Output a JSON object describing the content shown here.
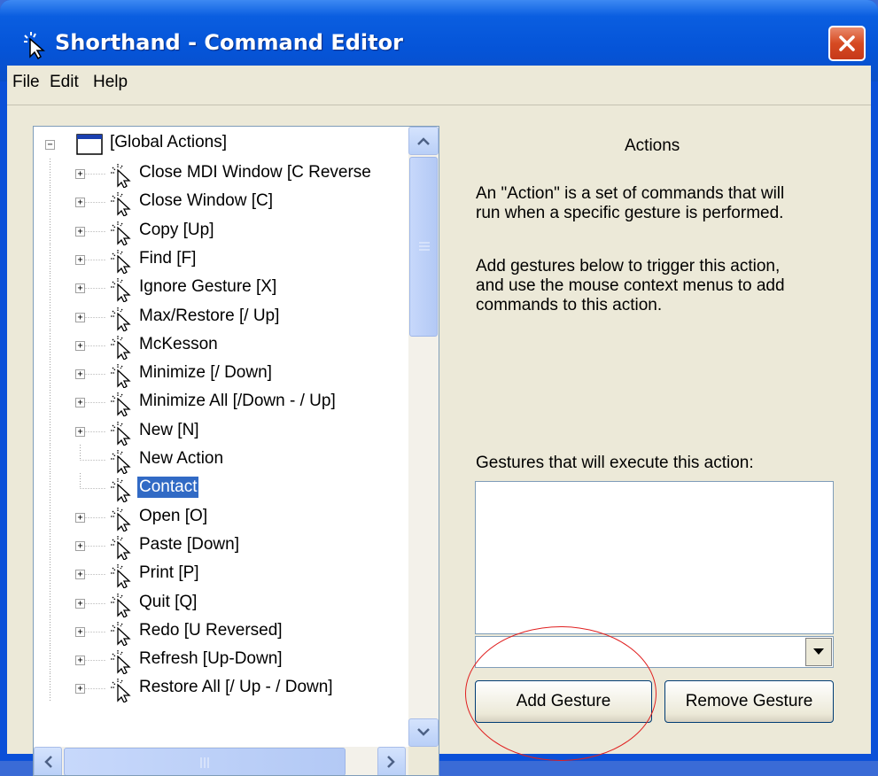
{
  "window": {
    "title": "Shorthand - Command Editor",
    "close_label": "×"
  },
  "menu": [
    "File",
    "Edit",
    "Help"
  ],
  "tree": {
    "root_label": "[Global Actions]",
    "items": [
      {
        "label": "Close MDI Window [C Reverse",
        "expander": "+"
      },
      {
        "label": "Close Window [C]",
        "expander": "+"
      },
      {
        "label": "Copy [Up]",
        "expander": "+"
      },
      {
        "label": "Find [F]",
        "expander": "+"
      },
      {
        "label": "Ignore Gesture [X]",
        "expander": "+"
      },
      {
        "label": "Max/Restore [/ Up]",
        "expander": "+"
      },
      {
        "label": "McKesson",
        "expander": "+"
      },
      {
        "label": "Minimize [/ Down]",
        "expander": "+"
      },
      {
        "label": "Minimize All [/Down - / Up]",
        "expander": "+"
      },
      {
        "label": "New [N]",
        "expander": "+"
      },
      {
        "label": "New Action",
        "expander": ""
      },
      {
        "label": "Contact",
        "expander": "",
        "selected": true
      },
      {
        "label": "Open [O]",
        "expander": "+"
      },
      {
        "label": "Paste [Down]",
        "expander": "+"
      },
      {
        "label": "Print [P]",
        "expander": "+"
      },
      {
        "label": "Quit [Q]",
        "expander": "+"
      },
      {
        "label": "Redo [U Reversed]",
        "expander": "+"
      },
      {
        "label": "Refresh [Up-Down]",
        "expander": "+"
      },
      {
        "label": "Restore All [/ Up - / Down]",
        "expander": "+"
      }
    ]
  },
  "panel": {
    "heading": "Actions",
    "description_1": [
      "An \"Action\" is a set of commands that will",
      "run when a specific gesture is performed."
    ],
    "description_2": [
      "Add gestures below to trigger this action,",
      "and use the mouse context menus to add",
      "commands to this action."
    ],
    "gestures_label": "Gestures that will execute this action:",
    "combo_value": "",
    "add_button": "Add Gesture",
    "remove_button": "Remove Gesture"
  },
  "colors": {
    "titlebar": "#0554d8",
    "selection": "#316ac5",
    "annotation_circle": "#e02020"
  }
}
